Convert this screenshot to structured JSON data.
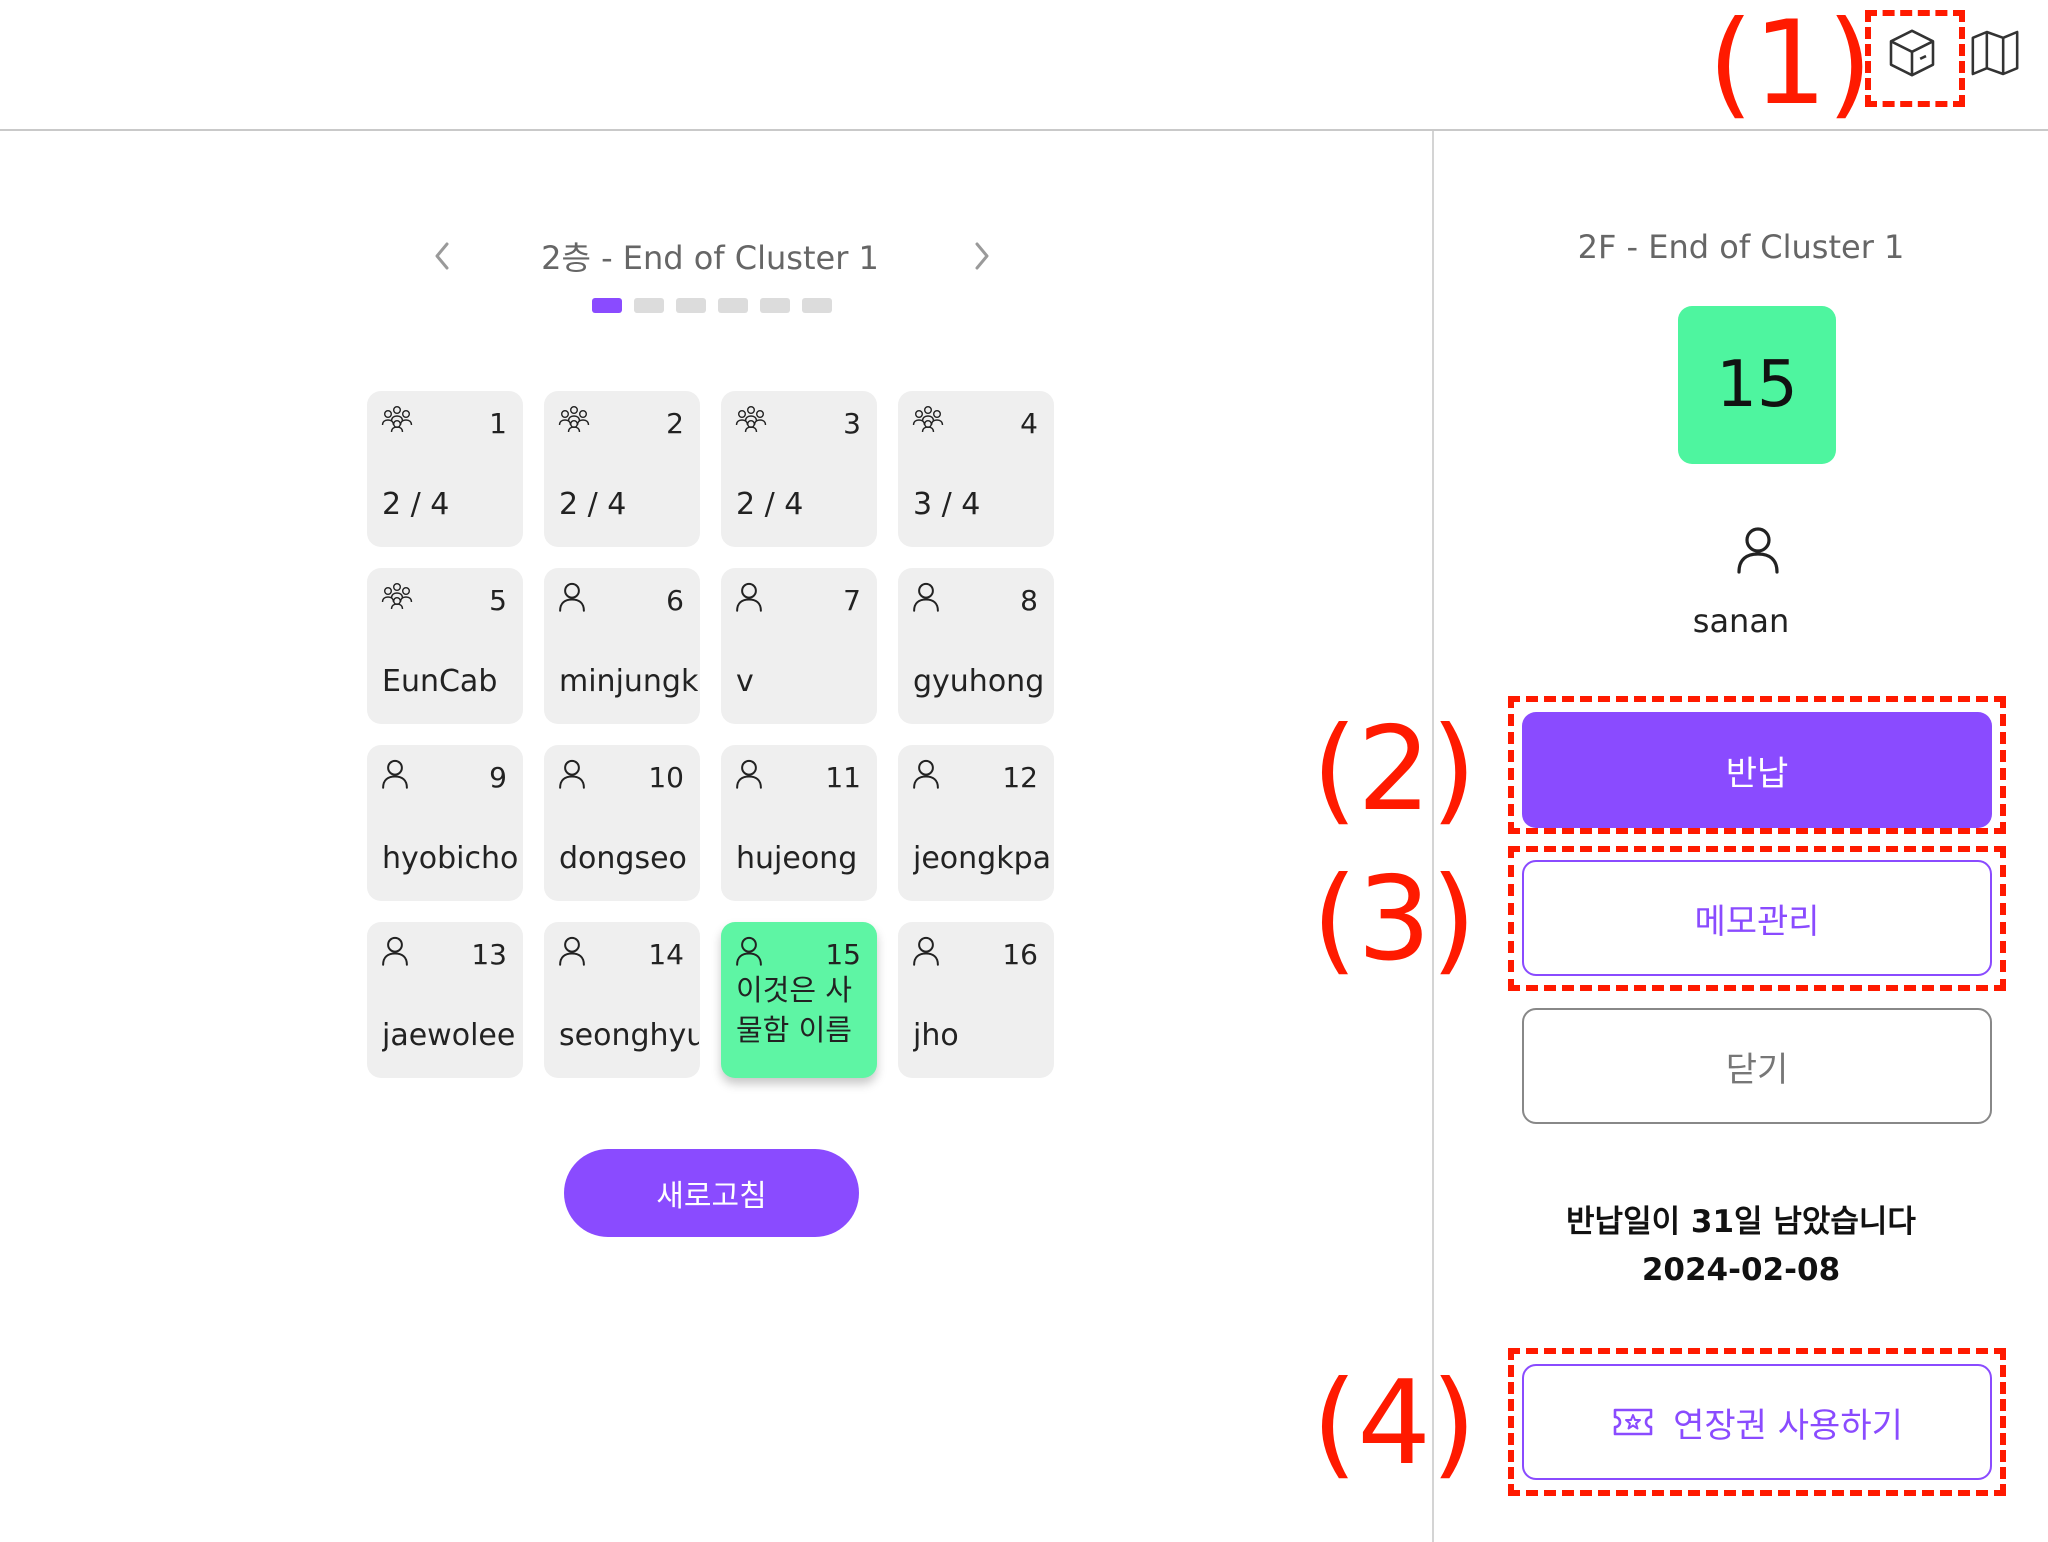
{
  "header": {
    "icons": [
      "cube-icon",
      "map-icon"
    ]
  },
  "floor": {
    "title": "2층 - End of Cluster 1",
    "page_count": 6,
    "active_page": 1
  },
  "lockers": [
    {
      "number": "1",
      "icon": "group-icon",
      "label": "2 / 4",
      "selected": false
    },
    {
      "number": "2",
      "icon": "group-icon",
      "label": "2 / 4",
      "selected": false
    },
    {
      "number": "3",
      "icon": "group-icon",
      "label": "2 / 4",
      "selected": false
    },
    {
      "number": "4",
      "icon": "group-icon",
      "label": "3 / 4",
      "selected": false
    },
    {
      "number": "5",
      "icon": "group-icon",
      "label": "EunCab",
      "selected": false
    },
    {
      "number": "6",
      "icon": "user-icon",
      "label": "minjungk",
      "selected": false
    },
    {
      "number": "7",
      "icon": "user-icon",
      "label": "v",
      "selected": false
    },
    {
      "number": "8",
      "icon": "user-icon",
      "label": "gyuhong",
      "selected": false
    },
    {
      "number": "9",
      "icon": "user-icon",
      "label": "hyobicho",
      "selected": false
    },
    {
      "number": "10",
      "icon": "user-icon",
      "label": "dongseo",
      "selected": false
    },
    {
      "number": "11",
      "icon": "user-icon",
      "label": "hujeong",
      "selected": false
    },
    {
      "number": "12",
      "icon": "user-icon",
      "label": "jeongkpa",
      "selected": false
    },
    {
      "number": "13",
      "icon": "user-icon",
      "label": "jaewolee",
      "selected": false
    },
    {
      "number": "14",
      "icon": "user-icon",
      "label": "seonghyu",
      "selected": false
    },
    {
      "number": "15",
      "icon": "user-icon",
      "label": "이것은 사물함 이름",
      "selected": true
    },
    {
      "number": "16",
      "icon": "user-icon",
      "label": "jho",
      "selected": false
    }
  ],
  "refresh_label": "새로고침",
  "detail": {
    "title": "2F - End of Cluster 1",
    "number": "15",
    "user": "sanan",
    "return_label": "반납",
    "memo_label": "메모관리",
    "close_label": "닫기",
    "remaining_text": "반납일이 31일 남았습니다",
    "due_date": "2024-02-08",
    "extend_label": "연장권 사용하기"
  },
  "annotations": [
    "(1)",
    "(2)",
    "(3)",
    "(4)"
  ],
  "colors": {
    "accent": "#8a4bff",
    "selected_locker": "#5ef5a4",
    "locker_bg": "#efefef",
    "annotation": "#ff1a00"
  }
}
